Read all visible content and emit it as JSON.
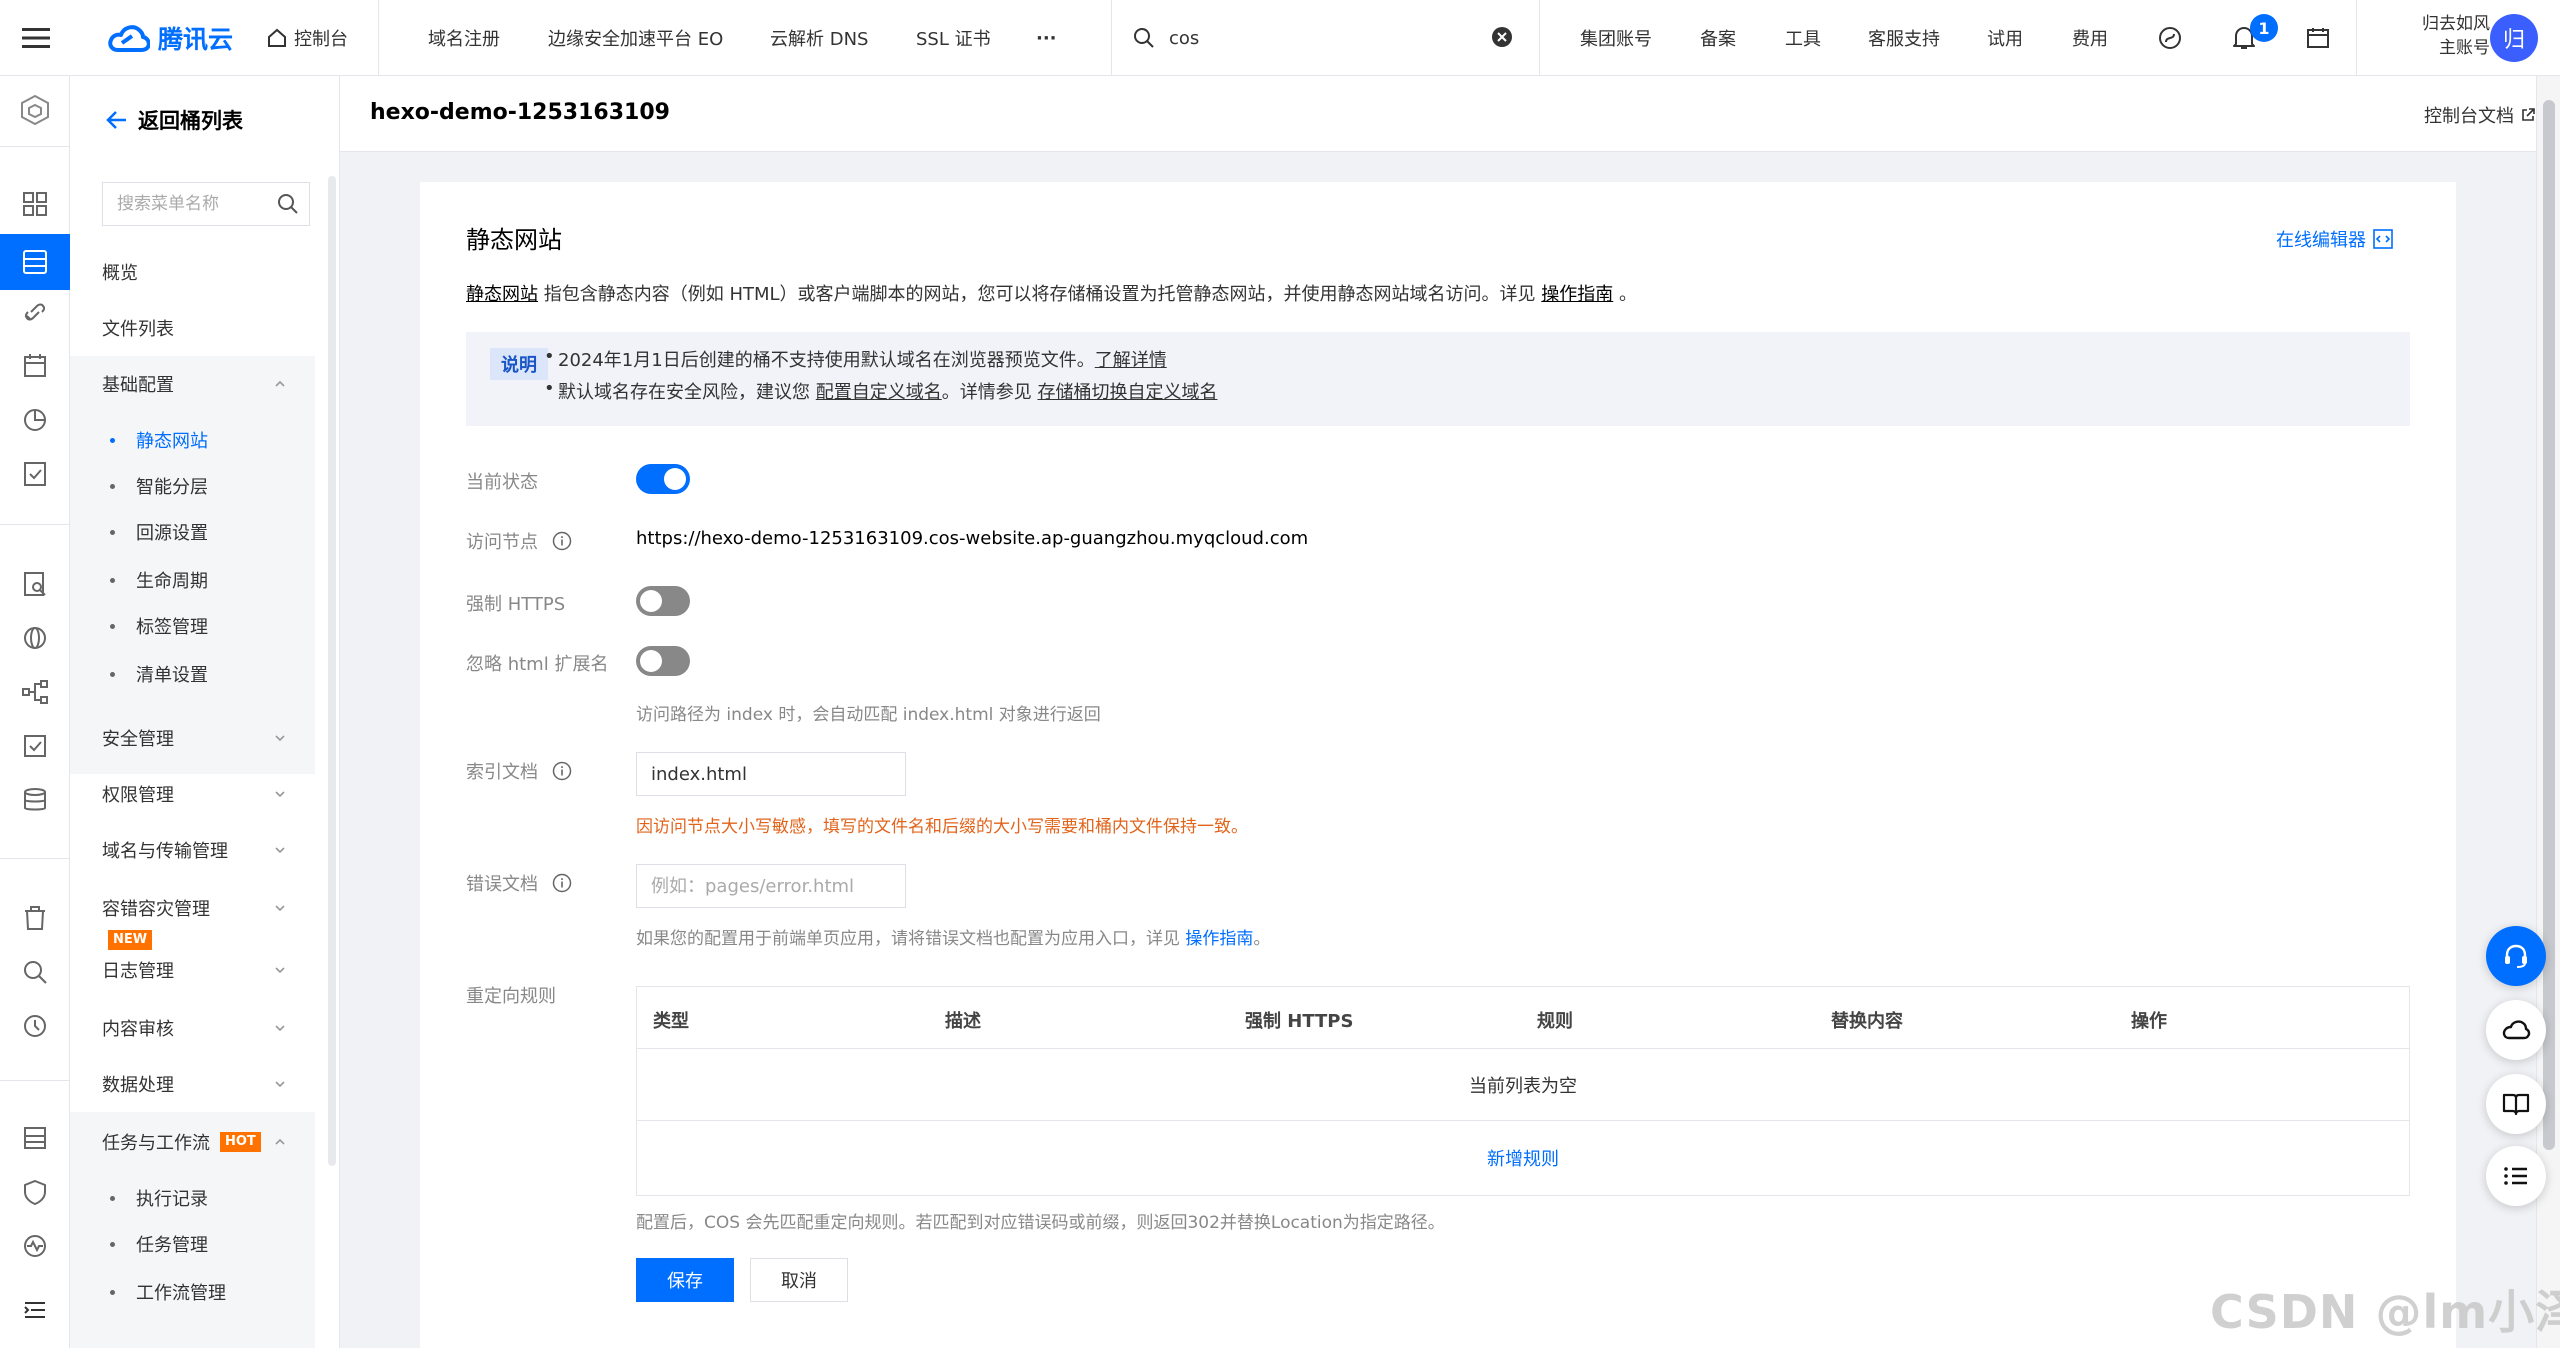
{
  "topbar": {
    "brand": "腾讯云",
    "console": "控制台",
    "nav": [
      "域名注册",
      "边缘安全加速平台 EO",
      "云解析 DNS",
      "SSL 证书",
      "···"
    ],
    "search_value": "cos",
    "right_links": [
      "集团账号",
      "备案",
      "工具",
      "客服支持",
      "试用",
      "费用"
    ],
    "notification_count": "1",
    "user_name": "归去如风",
    "user_role": "主账号",
    "avatar_text": "归"
  },
  "sidebar": {
    "back_label": "返回桶列表",
    "search_placeholder": "搜索菜单名称",
    "items": {
      "overview": "概览",
      "file_list": "文件列表",
      "basic_config": "基础配置",
      "security": "安全管理",
      "permissions": "权限管理",
      "domain_transfer": "域名与传输管理",
      "disaster": "容错容灾管理",
      "logs": "日志管理",
      "content_audit": "内容审核",
      "data_processing": "数据处理",
      "tasks": "任务与工作流"
    },
    "basic_sub": [
      "静态网站",
      "智能分层",
      "回源设置",
      "生命周期",
      "标签管理",
      "清单设置"
    ],
    "task_sub": [
      "执行记录",
      "任务管理",
      "工作流管理"
    ],
    "tag_new": "NEW",
    "tag_hot": "HOT"
  },
  "page": {
    "bucket_name": "hexo-demo-1253163109",
    "console_docs": "控制台文档"
  },
  "card": {
    "title": "静态网站",
    "online_editor": "在线编辑器",
    "intro": {
      "link1": "静态网站",
      "text": " 指包含静态内容（例如 HTML）或客户端脚本的网站，您可以将存储桶设置为托管静态网站，并使用静态网站域名访问。详见 ",
      "link2": "操作指南",
      "end": " 。"
    },
    "note": {
      "badge": "说明",
      "line1_text": "2024年1月1日后创建的桶不支持使用默认域名在浏览器预览文件。",
      "line1_link": "了解详情",
      "line2_text": "默认域名存在安全风险，建议您 ",
      "line2_link1": "配置自定义域名",
      "line2_mid": "。详情参见 ",
      "line2_link2": "存储桶切换自定义域名"
    },
    "fields": {
      "status_label": "当前状态",
      "status_on": true,
      "endpoint_label": "访问节点",
      "endpoint_value": "https://hexo-demo-1253163109.cos-website.ap-guangzhou.myqcloud.com",
      "https_label": "强制 HTTPS",
      "https_on": false,
      "ignore_html_label": "忽略 html 扩展名",
      "ignore_html_on": false,
      "ignore_html_hint": "访问路径为 index 时，会自动匹配 index.html 对象进行返回",
      "index_label": "索引文档",
      "index_value": "index.html",
      "index_warning": "因访问节点大小写敏感，填写的文件名和后缀的大小写需要和桶内文件保持一致。",
      "error_label": "错误文档",
      "error_placeholder": "例如：pages/error.html",
      "error_hint_text": "如果您的配置用于前端单页应用，请将错误文档也配置为应用入口，详见 ",
      "error_hint_link": "操作指南",
      "error_hint_end": "。",
      "redirect_label": "重定向规则"
    },
    "redirect_table": {
      "columns": [
        "类型",
        "描述",
        "强制 HTTPS",
        "规则",
        "替换内容",
        "操作"
      ],
      "empty": "当前列表为空",
      "add_rule": "新增规则"
    },
    "footer_hint": "配置后，COS 会先匹配重定向规则。若匹配到对应错误码或前缀，则返回302并替换Location为指定路径。",
    "save": "保存",
    "cancel": "取消"
  },
  "watermark": "CSDN @lm小泽",
  "colors": {
    "accent": "#006eff",
    "warning": "#e2641b",
    "badge_orange": "#ff7200"
  }
}
